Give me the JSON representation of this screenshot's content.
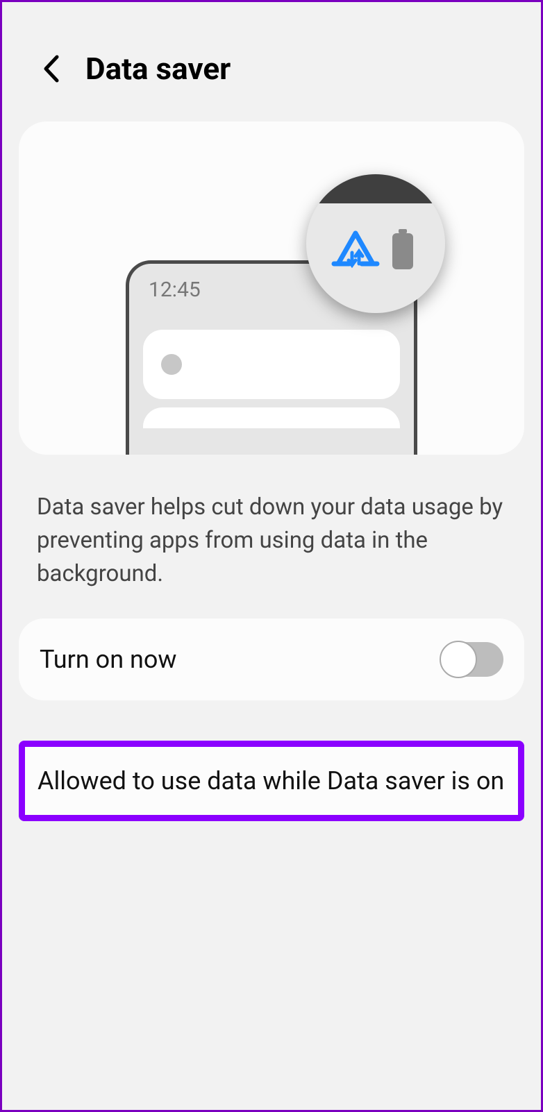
{
  "header": {
    "title": "Data saver"
  },
  "illustration": {
    "time": "12:45"
  },
  "description": "Data saver helps cut down your data usage by preventing apps from using data in the background.",
  "toggle": {
    "label": "Turn on now",
    "on": false
  },
  "allowed": {
    "label": "Allowed to use data while Data saver is on"
  }
}
